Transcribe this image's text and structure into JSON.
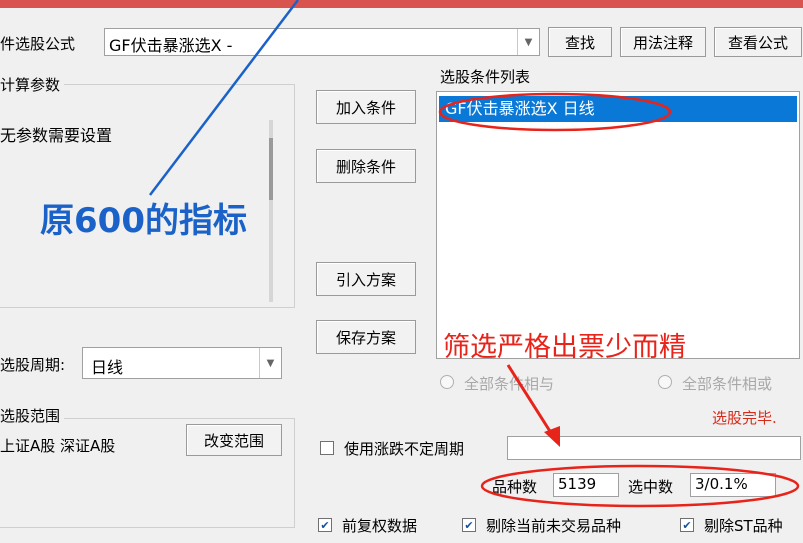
{
  "formula": {
    "label": "件选股公式",
    "value": "GF伏击暴涨选X  -",
    "find_btn": "查找",
    "usage_btn": "用法注释",
    "view_btn": "查看公式"
  },
  "params": {
    "title": "计算参数",
    "text": "无参数需要设置"
  },
  "cycle": {
    "label": "选股周期:",
    "value": "日线"
  },
  "range": {
    "title": "选股范围",
    "text": "上证A股 深证A股",
    "change_btn": "改变范围"
  },
  "middle_buttons": {
    "add": "加入条件",
    "delete": "删除条件",
    "import": "引入方案",
    "save": "保存方案"
  },
  "conditions": {
    "title": "选股条件列表",
    "items": [
      "GF伏击暴涨选X  日线"
    ]
  },
  "logic": {
    "and_label": "全部条件相与",
    "or_label": "全部条件相或",
    "selected": "and"
  },
  "status": "选股完毕.",
  "updown": {
    "label": "使用涨跌不定周期",
    "checked": false
  },
  "stats": {
    "count_label": "品种数",
    "count_value": "5139",
    "selected_label": "选中数",
    "selected_value": "3/0.1%"
  },
  "options": {
    "adjust": "前复权数据",
    "exclude_untraded": "剔除当前未交易品种",
    "exclude_st": "剔除ST品种"
  },
  "annotations": {
    "indicator": "原600的指标",
    "note": "筛选严格出票少而精"
  },
  "colors": {
    "accent": "#0a78d7",
    "annotation_red": "#e8231a",
    "annotation_blue": "#1a62c8",
    "status_red": "#d62a1a"
  }
}
